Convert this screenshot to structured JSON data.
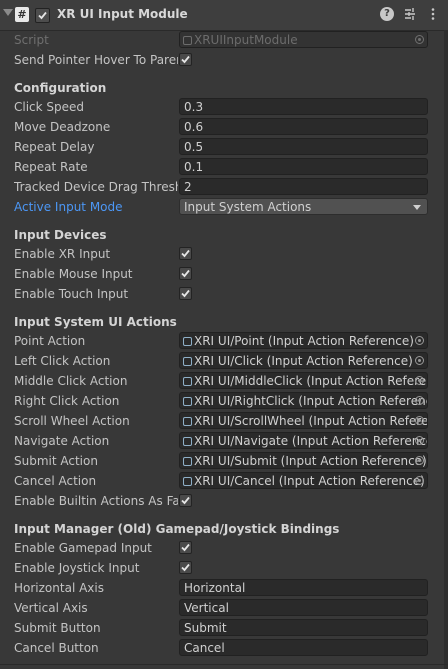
{
  "header": {
    "title": "XR UI Input Module",
    "script_badge": "#",
    "icons": [
      "help-icon",
      "preset-icon",
      "kebab-menu-icon"
    ]
  },
  "script": {
    "label": "Script",
    "value": "XRUIInputModule"
  },
  "send_hover": {
    "label": "Send Pointer Hover To Parent",
    "checked": true
  },
  "configuration": {
    "title": "Configuration",
    "click_speed": {
      "label": "Click Speed",
      "value": "0.3"
    },
    "move_deadzone": {
      "label": "Move Deadzone",
      "value": "0.6"
    },
    "repeat_delay": {
      "label": "Repeat Delay",
      "value": "0.5"
    },
    "repeat_rate": {
      "label": "Repeat Rate",
      "value": "0.1"
    },
    "drag_threshold": {
      "label": "Tracked Device Drag Threshold",
      "value": "2"
    },
    "active_input_mode": {
      "label": "Active Input Mode",
      "value": "Input System Actions"
    }
  },
  "input_devices": {
    "title": "Input Devices",
    "xr": {
      "label": "Enable XR Input",
      "checked": true
    },
    "mouse": {
      "label": "Enable Mouse Input",
      "checked": true
    },
    "touch": {
      "label": "Enable Touch Input",
      "checked": true
    }
  },
  "ui_actions": {
    "title": "Input System UI Actions",
    "rows": [
      {
        "label": "Point Action",
        "value": "XRI UI/Point (Input Action Reference)"
      },
      {
        "label": "Left Click Action",
        "value": "XRI UI/Click (Input Action Reference)"
      },
      {
        "label": "Middle Click Action",
        "value": "XRI UI/MiddleClick (Input Action Reference)"
      },
      {
        "label": "Right Click Action",
        "value": "XRI UI/RightClick (Input Action Reference)"
      },
      {
        "label": "Scroll Wheel Action",
        "value": "XRI UI/ScrollWheel (Input Action Reference)"
      },
      {
        "label": "Navigate Action",
        "value": "XRI UI/Navigate (Input Action Reference)"
      },
      {
        "label": "Submit Action",
        "value": "XRI UI/Submit (Input Action Reference)"
      },
      {
        "label": "Cancel Action",
        "value": "XRI UI/Cancel (Input Action Reference)"
      }
    ],
    "builtin": {
      "label": "Enable Builtin Actions As Fallback",
      "checked": true
    }
  },
  "legacy": {
    "title": "Input Manager (Old) Gamepad/Joystick Bindings",
    "gamepad": {
      "label": "Enable Gamepad Input",
      "checked": true
    },
    "joystick": {
      "label": "Enable Joystick Input",
      "checked": true
    },
    "horizontal": {
      "label": "Horizontal Axis",
      "value": "Horizontal"
    },
    "vertical": {
      "label": "Vertical Axis",
      "value": "Vertical"
    },
    "submit": {
      "label": "Submit Button",
      "value": "Submit"
    },
    "cancel": {
      "label": "Cancel Button",
      "value": "Cancel"
    }
  },
  "colors": {
    "background": "#383838",
    "field": "#2a2a2a",
    "accent_label": "#4c97f5"
  }
}
